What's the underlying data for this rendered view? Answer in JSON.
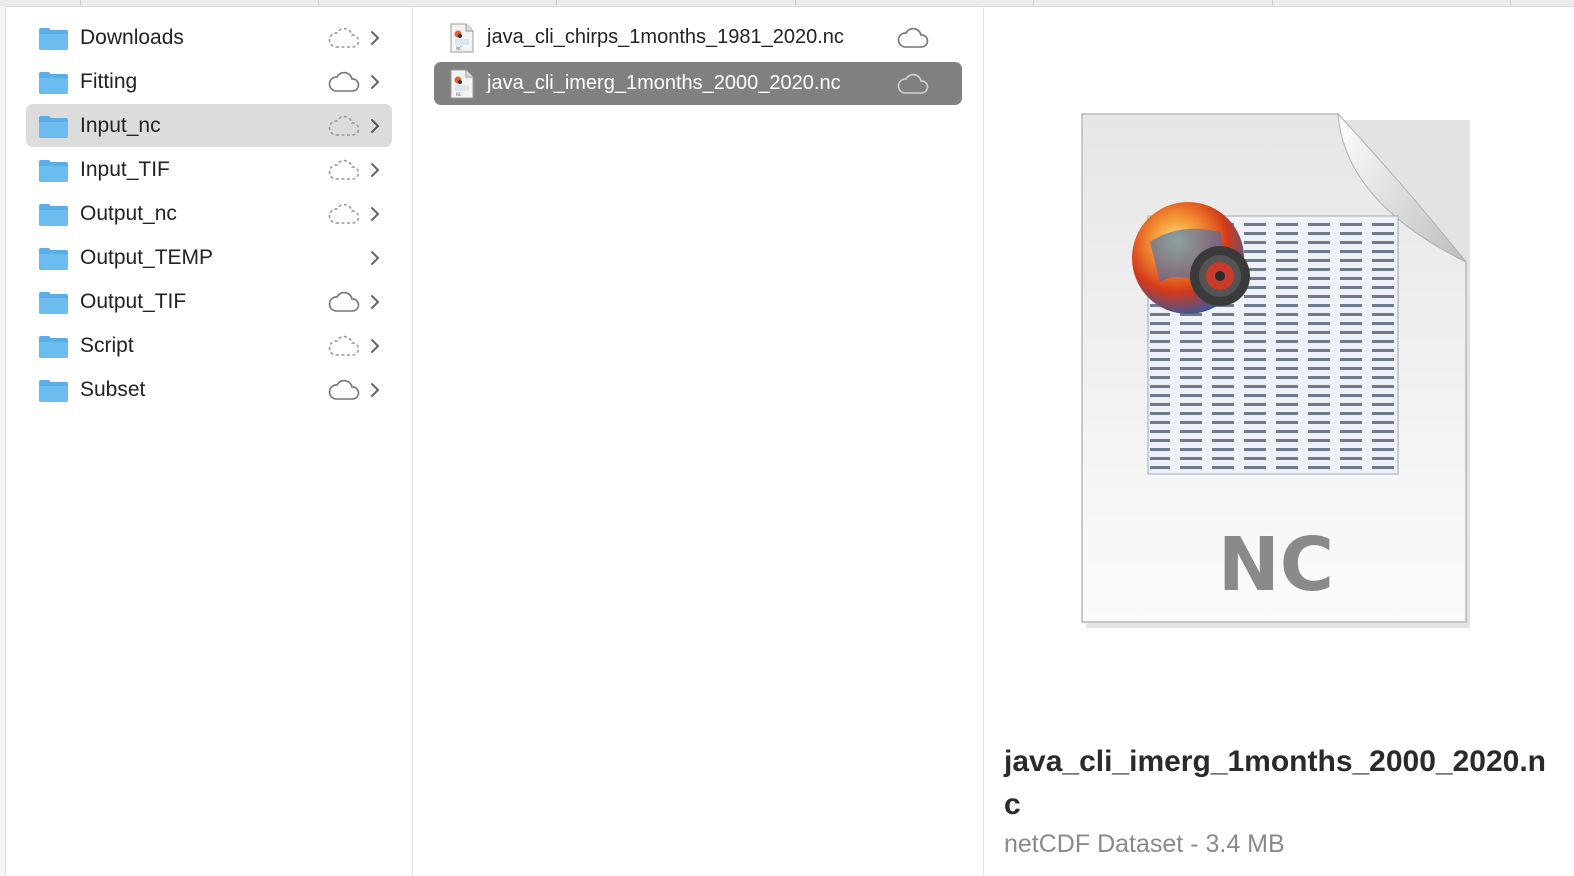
{
  "sidebar": {
    "items": [
      {
        "label": "Downloads",
        "cloud": "dashed"
      },
      {
        "label": "Fitting",
        "cloud": "solid"
      },
      {
        "label": "Input_nc",
        "cloud": "dashed",
        "active": true
      },
      {
        "label": "Input_TIF",
        "cloud": "dashed"
      },
      {
        "label": "Output_nc",
        "cloud": "dashed"
      },
      {
        "label": "Output_TEMP",
        "cloud": "none"
      },
      {
        "label": "Output_TIF",
        "cloud": "solid"
      },
      {
        "label": "Script",
        "cloud": "dashed"
      },
      {
        "label": "Subset",
        "cloud": "solid"
      }
    ]
  },
  "files": {
    "items": [
      {
        "label": "java_cli_chirps_1months_1981_2020.nc",
        "selected": false
      },
      {
        "label": "java_cli_imerg_1months_2000_2020.nc",
        "selected": true
      }
    ]
  },
  "preview": {
    "icon_text": "NC",
    "filename": "java_cli_imerg_1months_2000_2020.nc",
    "kind": "netCDF Dataset",
    "separator": "-",
    "size": "3.4 MB"
  },
  "colors": {
    "folder": "#5aaee8",
    "selection": "#808080",
    "active_row": "#dcdcdc"
  }
}
